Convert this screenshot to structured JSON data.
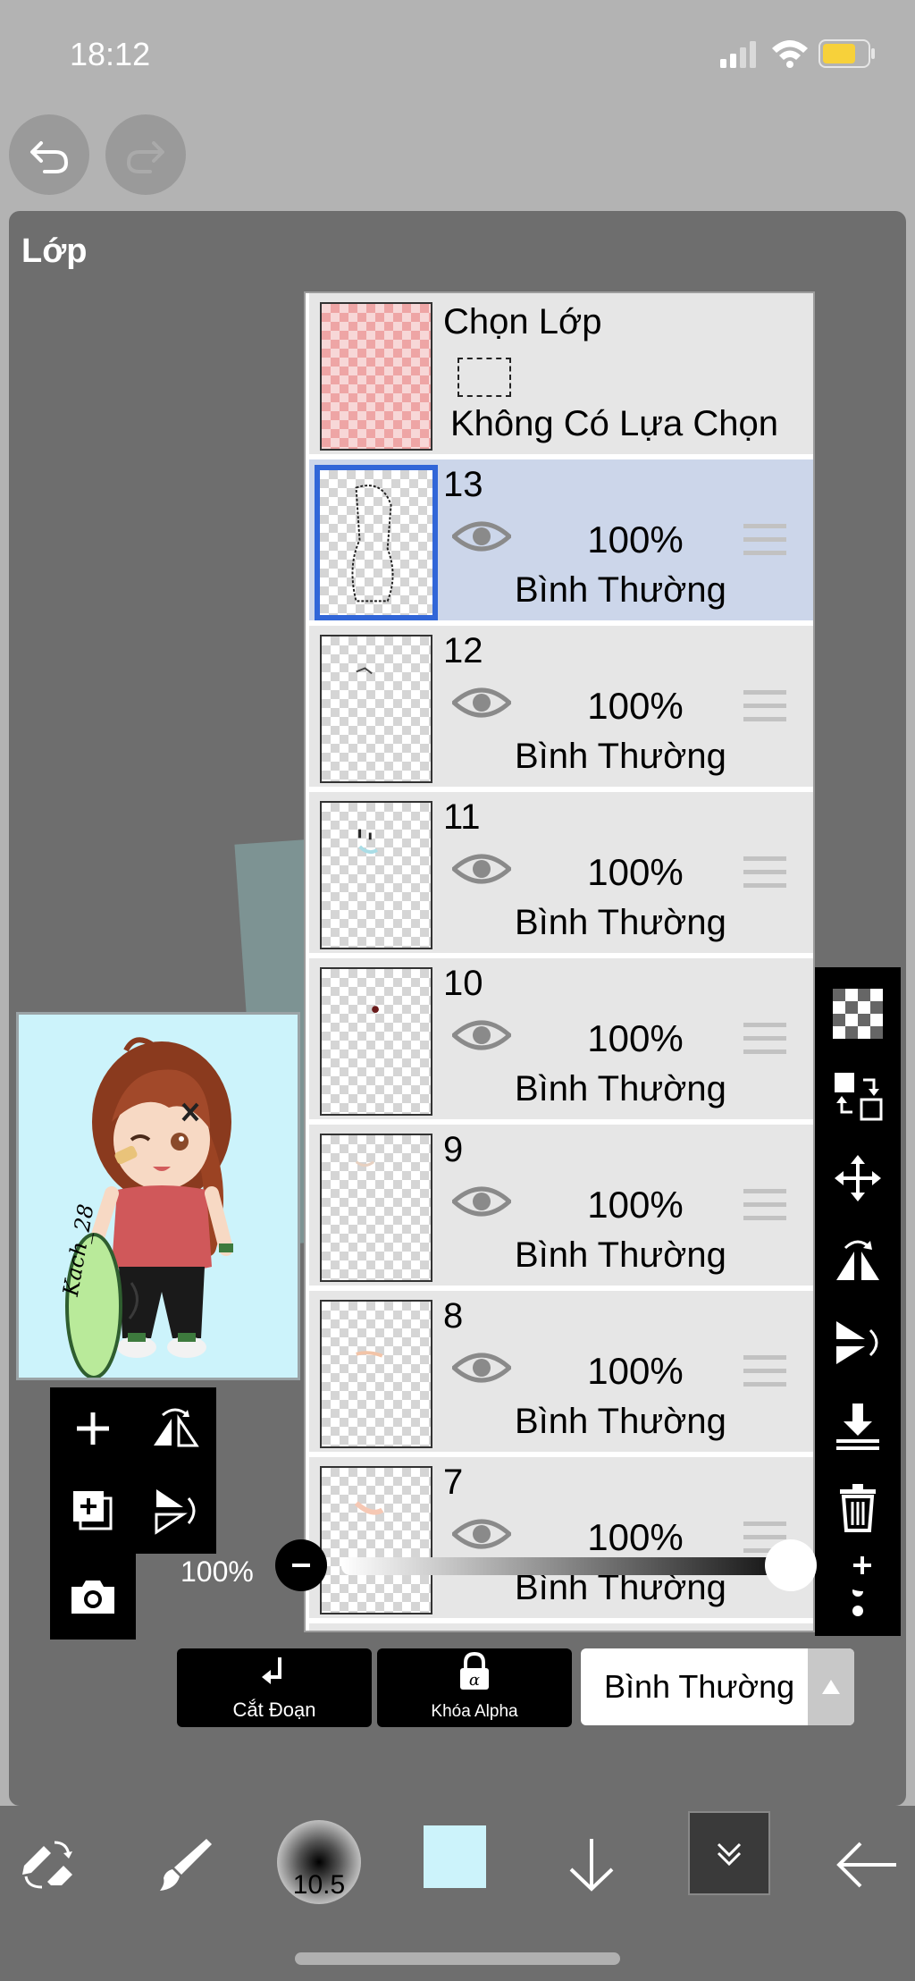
{
  "status": {
    "time": "18:12"
  },
  "panel": {
    "title": "Lớp"
  },
  "selection_layer": {
    "title": "Chọn Lớp",
    "state": "Không Có Lựa Chọn"
  },
  "layers": [
    {
      "number": "13",
      "opacity": "100%",
      "blend": "Bình Thường",
      "active": true
    },
    {
      "number": "12",
      "opacity": "100%",
      "blend": "Bình Thường",
      "active": false
    },
    {
      "number": "11",
      "opacity": "100%",
      "blend": "Bình Thường",
      "active": false
    },
    {
      "number": "10",
      "opacity": "100%",
      "blend": "Bình Thường",
      "active": false
    },
    {
      "number": "9",
      "opacity": "100%",
      "blend": "Bình Thường",
      "active": false
    },
    {
      "number": "8",
      "opacity": "100%",
      "blend": "Bình Thường",
      "active": false
    },
    {
      "number": "7",
      "opacity": "100%",
      "blend": "Bình Thường",
      "active": false
    }
  ],
  "controls": {
    "clipping_label": "Cắt Đoạn",
    "alpha_lock_label": "Khóa Alpha",
    "blend_mode": "Bình Thường",
    "opacity_label": "100%",
    "opacity_value": 1.0
  },
  "toolbar": {
    "brush_size": "10.5",
    "color": "#ccf3fb"
  },
  "preview": {
    "signature_text": "Kach_28"
  }
}
